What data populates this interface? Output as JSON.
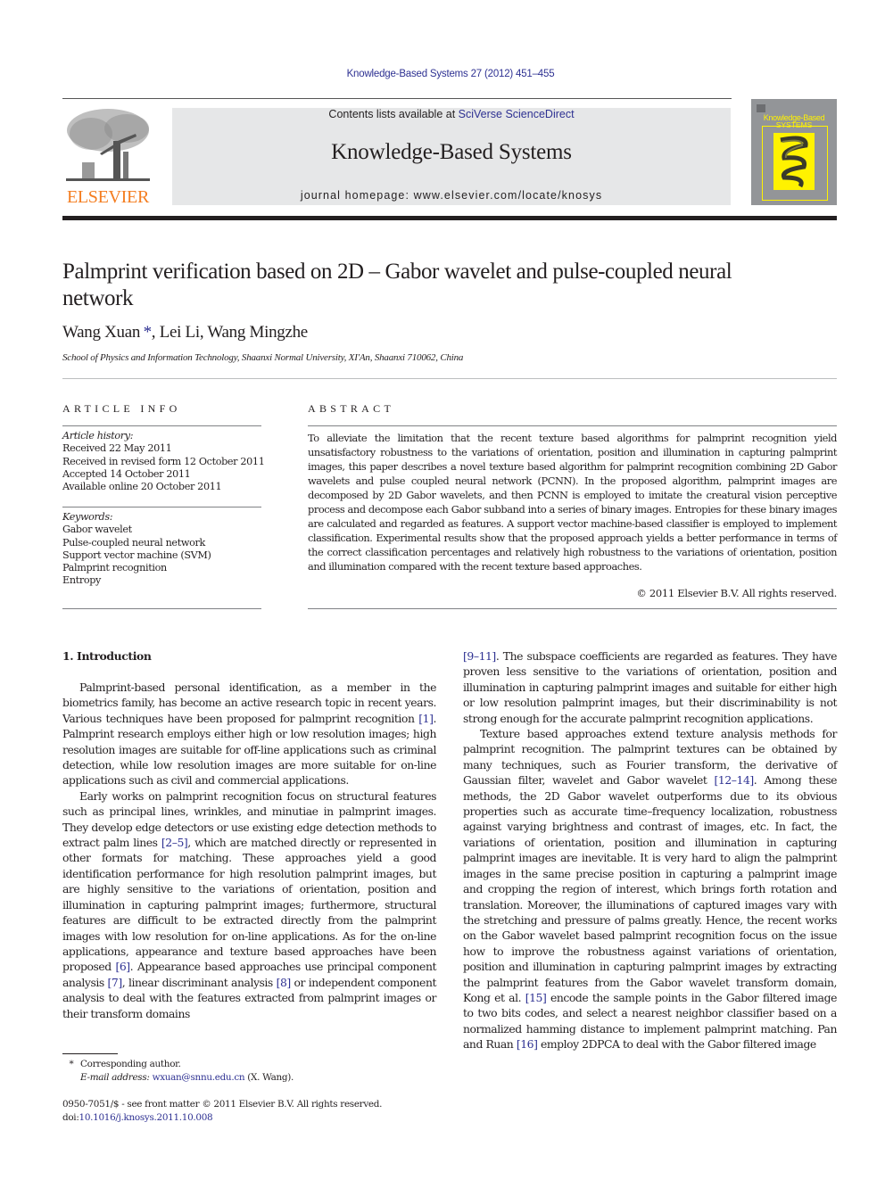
{
  "header": {
    "citation": "Knowledge-Based Systems 27 (2012) 451–455",
    "contents_prefix": "Contents lists available at ",
    "contents_link": "SciVerse ScienceDirect",
    "journal_name": "Knowledge-Based Systems",
    "homepage": "journal homepage: www.elsevier.com/locate/knosys",
    "publisher_logo_text": "ELSEVIER",
    "cover": {
      "title_line1": "Knowledge-Based",
      "title_line2": "SYSTEMS"
    }
  },
  "colors": {
    "link": "#2e3192",
    "elsevier_orange": "#f47d20",
    "banner_gray": "#e6e7e8",
    "cover_gray": "#939598",
    "cover_yellow": "#fff200"
  },
  "article": {
    "title": "Palmprint verification based on 2D – Gabor wavelet and pulse-coupled neural network",
    "authors": [
      {
        "name": "Wang Xuan",
        "corresponding_mark": "*"
      },
      {
        "name": "Lei Li"
      },
      {
        "name": "Wang Mingzhe"
      }
    ],
    "affiliation": "School of Physics and Information Technology, Shaanxi Normal University, XI'An, Shaanxi 710062, China"
  },
  "article_info": {
    "heading": "ARTICLE INFO",
    "history_label": "Article history:",
    "history": [
      "Received 22 May 2011",
      "Received in revised form 12 October 2011",
      "Accepted 14 October 2011",
      "Available online 20 October 2011"
    ],
    "keywords_label": "Keywords:",
    "keywords": [
      "Gabor wavelet",
      "Pulse-coupled neural network",
      "Support vector machine (SVM)",
      "Palmprint recognition",
      "Entropy"
    ]
  },
  "abstract": {
    "heading": "ABSTRACT",
    "text": "To alleviate the limitation that the recent texture based algorithms for palmprint recognition yield unsatisfactory robustness to the variations of orientation, position and illumination in capturing palmprint images, this paper describes a novel texture based algorithm for palmprint recognition combining 2D Gabor wavelets and pulse coupled neural network (PCNN). In the proposed algorithm, palmprint images are decomposed by 2D Gabor wavelets, and then PCNN is employed to imitate the creatural vision perceptive process and decompose each Gabor subband into a series of binary images. Entropies for these binary images are calculated and regarded as features. A support vector machine-based classifier is employed to implement classification. Experimental results show that the proposed approach yields a better performance in terms of the correct classification percentages and relatively high robustness to the variations of orientation, position and illumination compared with the recent texture based approaches.",
    "copyright": "© 2011 Elsevier B.V. All rights reserved."
  },
  "body": {
    "section_heading": "1. Introduction",
    "left_paragraphs": [
      [
        {
          "t": "Palmprint-based personal identification, as a member in the biometrics family, has become an active research topic in recent years. Various techniques have been proposed for palmprint recognition "
        },
        {
          "ref": "[1]"
        },
        {
          "t": ". Palmprint research employs either high or low resolution images; high resolution images are suitable for off-line applications such as criminal detection, while low resolution images are more suitable for on-line applications such as civil and commercial applications."
        }
      ],
      [
        {
          "t": "Early works on palmprint recognition focus on structural features such as principal lines, wrinkles, and minutiae in palmprint images. They develop edge detectors or use existing edge detection methods to extract palm lines "
        },
        {
          "ref": "[2–5]"
        },
        {
          "t": ", which are matched directly or represented in other formats for matching. These approaches yield a good identification performance for high resolution palmprint images, but are highly sensitive to the variations of orientation, position and illumination in capturing palmprint images; furthermore, structural features are difficult to be extracted directly from the palmprint images with low resolution for on-line applications. As for the on-line applications, appearance and texture based approaches have been proposed "
        },
        {
          "ref": "[6]"
        },
        {
          "t": ". Appearance based approaches use principal component analysis "
        },
        {
          "ref": "[7]"
        },
        {
          "t": ", linear discriminant analysis "
        },
        {
          "ref": "[8]"
        },
        {
          "t": " or independent component analysis to deal with the features extracted from palmprint images or their transform domains"
        }
      ]
    ],
    "right_paragraphs": [
      [
        {
          "ref": "[9–11]"
        },
        {
          "t": ". The subspace coefficients are regarded as features. They have proven less sensitive to the variations of orientation, position and illumination in capturing palmprint images and suitable for either high or low resolution palmprint images, but their discriminability is not strong enough for the accurate palmprint recognition applications."
        }
      ],
      [
        {
          "t": "Texture based approaches extend texture analysis methods for palmprint recognition. The palmprint textures can be obtained by many techniques, such as Fourier transform, the derivative of Gaussian filter, wavelet and Gabor wavelet "
        },
        {
          "ref": "[12–14]"
        },
        {
          "t": ". Among these methods, the 2D Gabor wavelet outperforms due to its obvious properties such as accurate time–frequency localization, robustness against varying brightness and contrast of images, etc. In fact, the variations of orientation, position and illumination in capturing palmprint images are inevitable. It is very hard to align the palmprint images in the same precise position in capturing a palmprint image and cropping the region of interest, which brings forth rotation and translation. Moreover, the illuminations of captured images vary with the stretching and pressure of palms greatly. Hence, the recent works on the Gabor wavelet based palmprint recognition focus on the issue how to improve the robustness against variations of orientation, position and illumination in capturing palmprint images by extracting the palmprint features from the Gabor wavelet transform domain, Kong et al. "
        },
        {
          "ref": "[15]"
        },
        {
          "t": " encode the sample points in the Gabor filtered image to two bits codes, and select a nearest neighbor classifier based on a normalized hamming distance to implement palmprint matching. Pan and Ruan "
        },
        {
          "ref": "[16]"
        },
        {
          "t": " employ 2DPCA to deal with the Gabor filtered image"
        }
      ]
    ]
  },
  "footnotes": {
    "star": "*",
    "corresponding": "Corresponding author.",
    "email_label": "E-mail address:",
    "email": "wxuan@snnu.edu.cn",
    "email_suffix": " (X. Wang).",
    "issn_line": "0950-7051/$ - see front matter © 2011 Elsevier B.V. All rights reserved.",
    "doi_prefix": "doi:",
    "doi": "10.1016/j.knosys.2011.10.008"
  }
}
